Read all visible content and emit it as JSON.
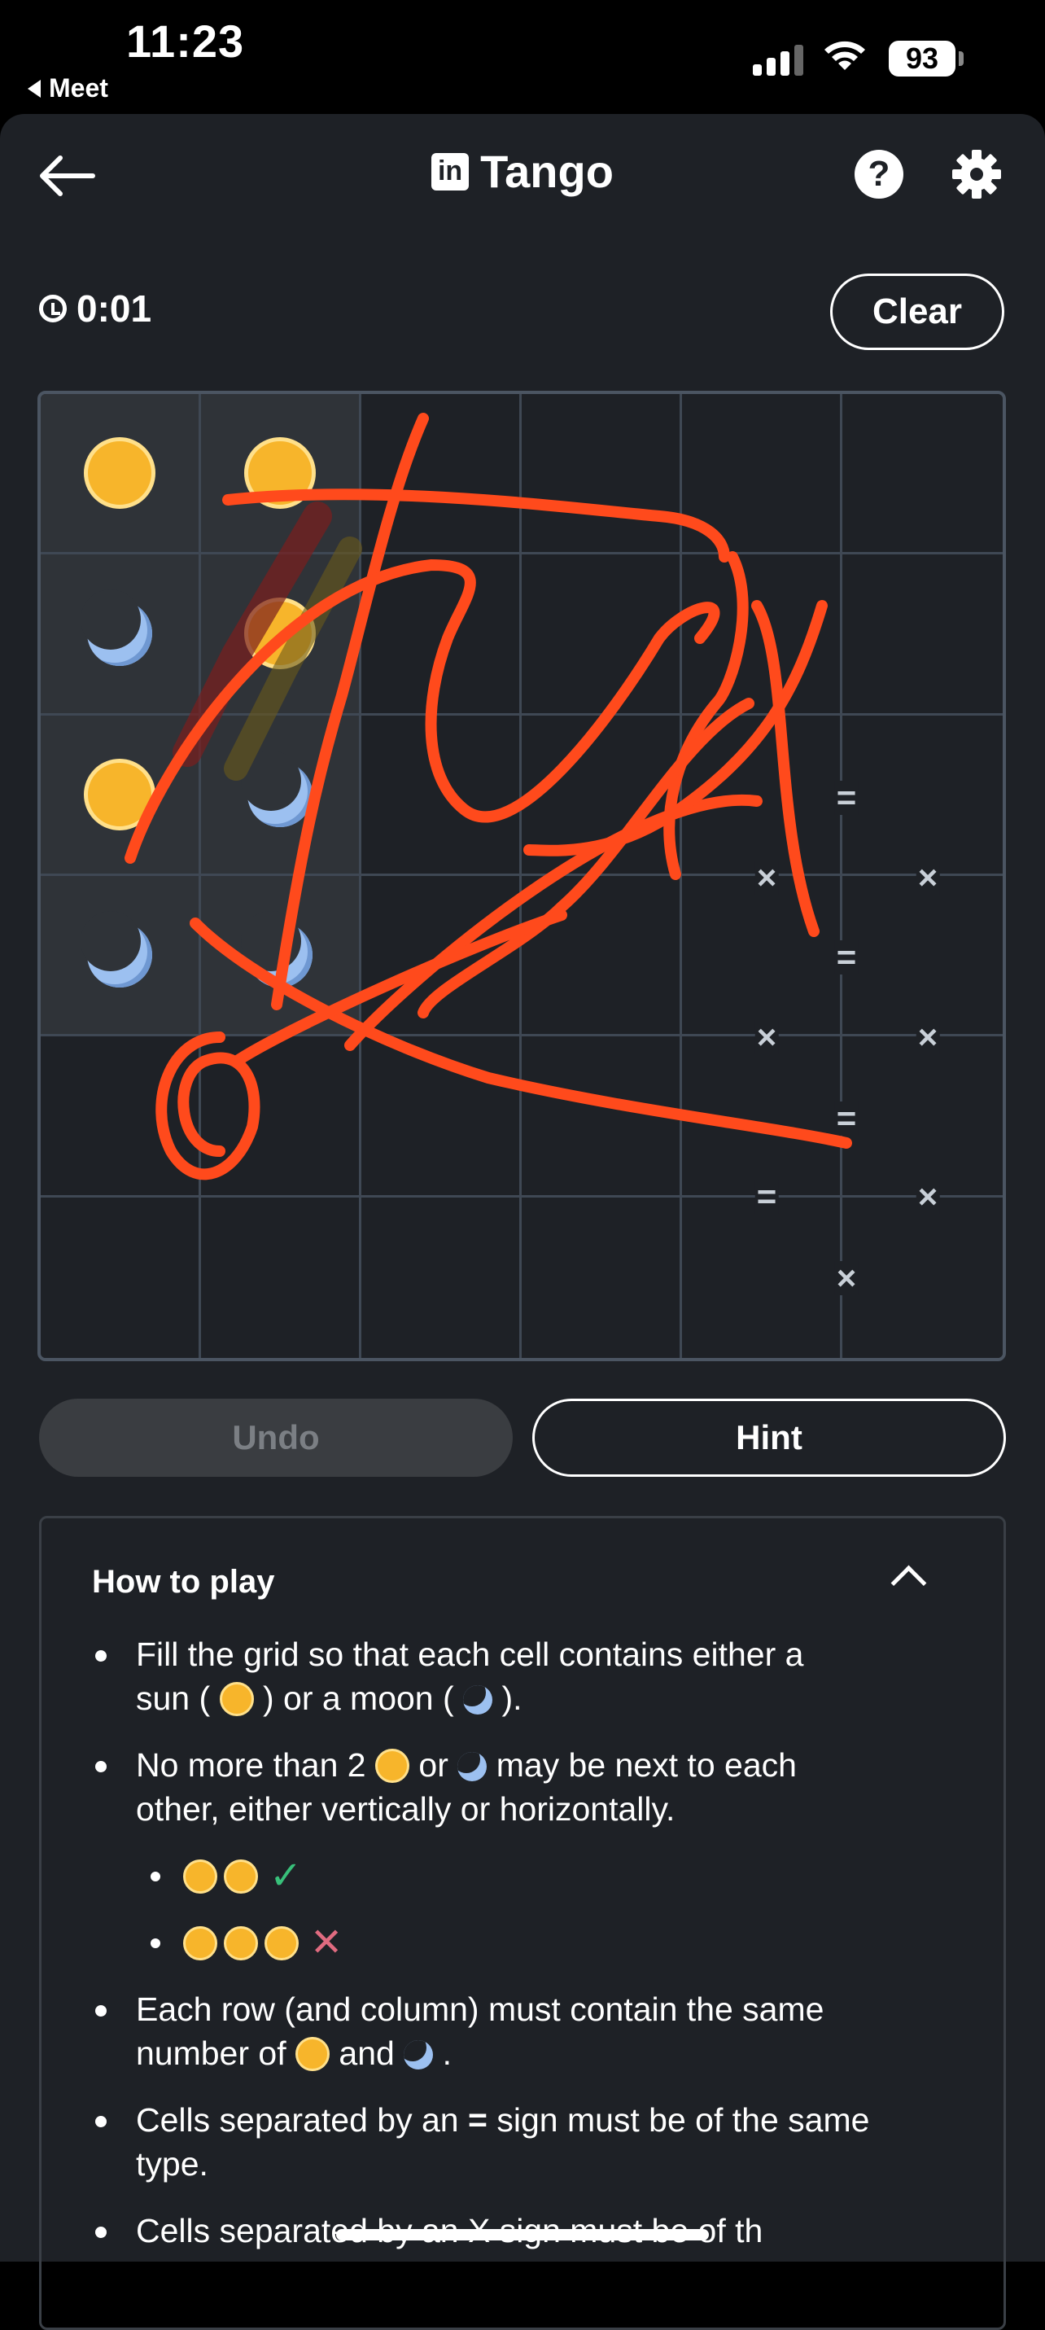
{
  "status_bar": {
    "time": "11:23",
    "back_app": "Meet",
    "battery": "93"
  },
  "header": {
    "title": "Tango",
    "logo_text": "in",
    "help_label": "?"
  },
  "game": {
    "timer": "0:01",
    "clear_label": "Clear",
    "undo_label": "Undo",
    "hint_label": "Hint",
    "board": [
      [
        "sun",
        "sun",
        "",
        "",
        "",
        ""
      ],
      [
        "moon",
        "sun",
        "",
        "",
        "",
        ""
      ],
      [
        "sun",
        "moon",
        "",
        "",
        "",
        ""
      ],
      [
        "moon",
        "moon",
        "",
        "",
        "",
        ""
      ],
      [
        "",
        "",
        "",
        "",
        "",
        ""
      ],
      [
        "",
        "",
        "",
        "",
        "",
        ""
      ]
    ],
    "locked_region": "rows 1-4, columns 1-2",
    "constraint_signs": [
      "=",
      "×",
      "×",
      "=",
      "×",
      "×",
      "=",
      "=",
      "×",
      "×"
    ],
    "annotation_color": "#ff4a1c"
  },
  "how_to_play": {
    "title": "How to play",
    "rule1_a": "Fill the grid so that each cell contains either a",
    "rule1_b": "sun (",
    "rule1_c": ") or a moon (",
    "rule1_d": ").",
    "rule2_a": "No more than 2",
    "rule2_b": "or",
    "rule2_c": "may be next to each",
    "rule2_d": "other, either vertically or horizontally.",
    "check_symbol": "✓",
    "cross_symbol": "✕",
    "rule3_a": "Each row (and column) must contain the same",
    "rule3_b": "number of",
    "rule3_c": "and",
    "rule3_d": ".",
    "rule4_a": "Cells separated by an",
    "rule4_sign": "=",
    "rule4_b": "sign must be of the same",
    "rule4_c": "type.",
    "rule5_partial": "Cells separated by an X sign must be of th"
  },
  "colors": {
    "background": "#1e2126",
    "sun": "#f7b52b",
    "moon": "#9cc0f0",
    "accent_check": "#38c07a",
    "accent_cross": "#e06b80"
  }
}
